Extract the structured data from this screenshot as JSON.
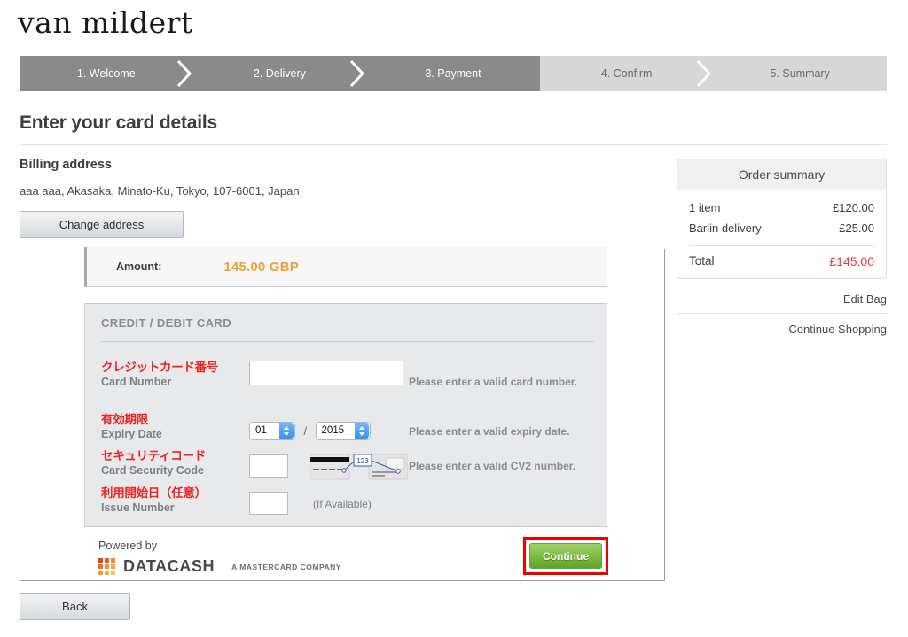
{
  "brand": {
    "logo_text": "van mildert"
  },
  "steps": [
    {
      "label": "1. Welcome",
      "state": "done"
    },
    {
      "label": "2. Delivery",
      "state": "done"
    },
    {
      "label": "3. Payment",
      "state": "active"
    },
    {
      "label": "4. Confirm",
      "state": "todo"
    },
    {
      "label": "5. Summary",
      "state": "todo"
    }
  ],
  "page": {
    "title": "Enter your card details"
  },
  "billing": {
    "heading": "Billing address",
    "address": "aaa aaa, Akasaka, Minato-Ku, Tokyo, 107-6001, Japan",
    "change_button": "Change address"
  },
  "order_summary": {
    "heading": "Order summary",
    "rows": [
      {
        "label": "1 item",
        "value": "£120.00"
      },
      {
        "label": "Barlin delivery",
        "value": "£25.00"
      }
    ],
    "total_label": "Total",
    "total_value": "£145.00",
    "total_color": "#e23c3c",
    "links": [
      {
        "label": "Edit Bag"
      },
      {
        "label": "Continue Shopping"
      }
    ]
  },
  "payment": {
    "amount_label": "Amount:",
    "amount_value": "145.00 GBP",
    "amount_color": "#e8a33d",
    "panel_title": "CREDIT / DEBIT CARD",
    "fields": {
      "card_number": {
        "label_jp": "クレジットカード番号",
        "label_en": "Card Number",
        "value": "",
        "hint": "Please enter a valid card number."
      },
      "expiry": {
        "label_jp": "有効期限",
        "label_en": "Expiry Date",
        "month": "01",
        "year": "2015",
        "separator": "/",
        "hint": "Please enter a valid expiry date."
      },
      "security_code": {
        "label_jp": "セキュリティコード",
        "label_en": "Card Security Code",
        "value": "",
        "hint": "Please enter a valid CV2 number.",
        "diagram_digits": "123"
      },
      "issue_number": {
        "label_jp": "利用開始日（任意）",
        "label_en": "Issue Number",
        "value": "",
        "hint": "(If Available)"
      }
    },
    "powered_by": "Powered by",
    "provider_name": "DATACASH",
    "provider_tagline": "A MASTERCARD COMPANY",
    "continue_button": "Continue",
    "continue_highlight_color": "#ee0000"
  },
  "footer": {
    "back_button": "Back"
  }
}
